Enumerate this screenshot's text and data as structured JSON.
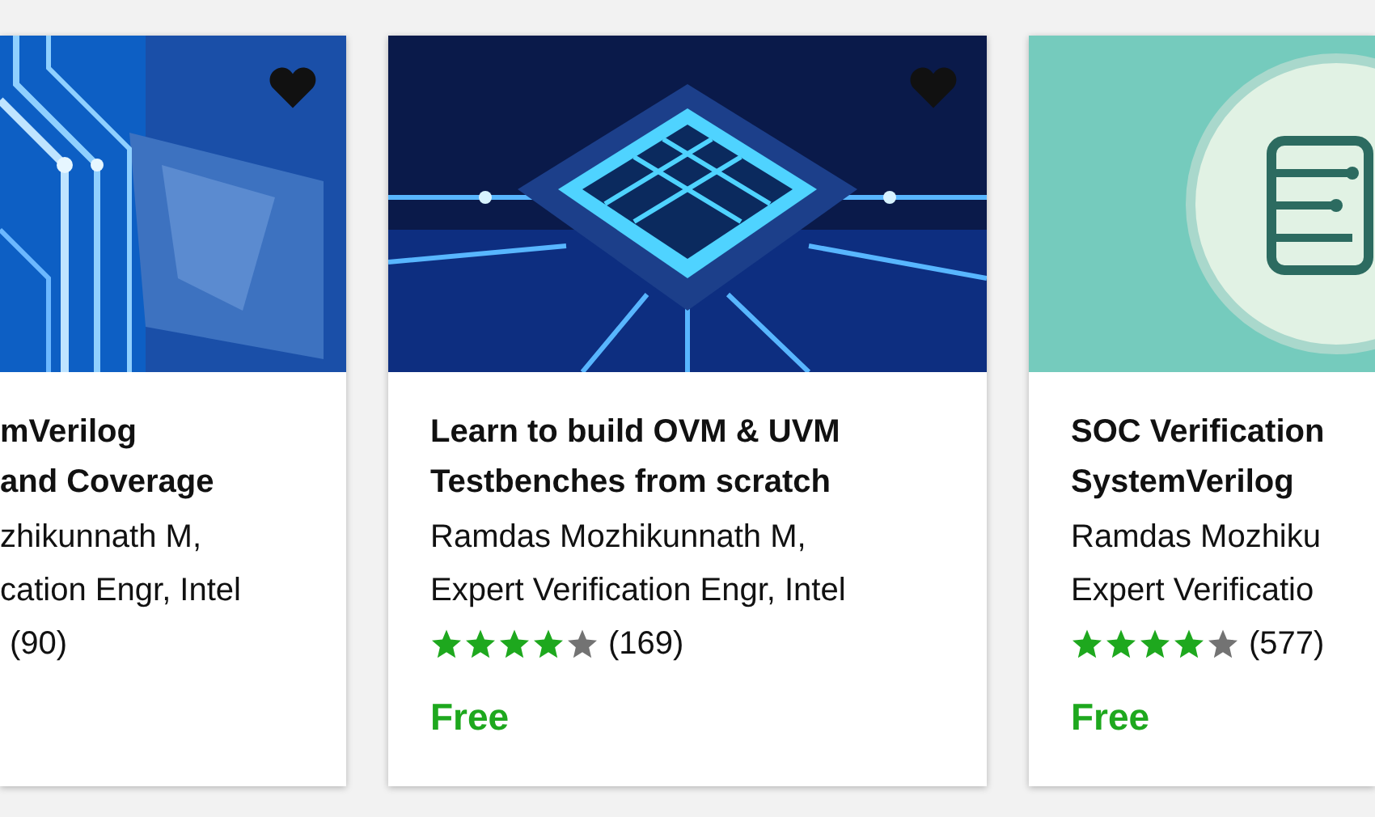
{
  "cards": [
    {
      "wishlist_icon": true,
      "title_lines": [
        "mVerilog",
        "and Coverage"
      ],
      "author_lines": [
        "zhikunnath M,",
        "cation Engr, Intel"
      ],
      "rating_count": "(90)"
    },
    {
      "wishlist_icon": true,
      "title_lines": [
        "Learn to build OVM & UVM",
        "Testbenches from scratch"
      ],
      "author_lines": [
        "Ramdas Mozhikunnath M,",
        "Expert Verification Engr, Intel"
      ],
      "stars": 4,
      "rating_count": "(169)",
      "price": "Free"
    },
    {
      "wishlist_icon": false,
      "title_lines": [
        "SOC Verification",
        "SystemVerilog"
      ],
      "author_lines": [
        "Ramdas Mozhiku",
        "Expert Verificatio"
      ],
      "stars": 4,
      "rating_count": "(577)",
      "price": "Free"
    }
  ]
}
